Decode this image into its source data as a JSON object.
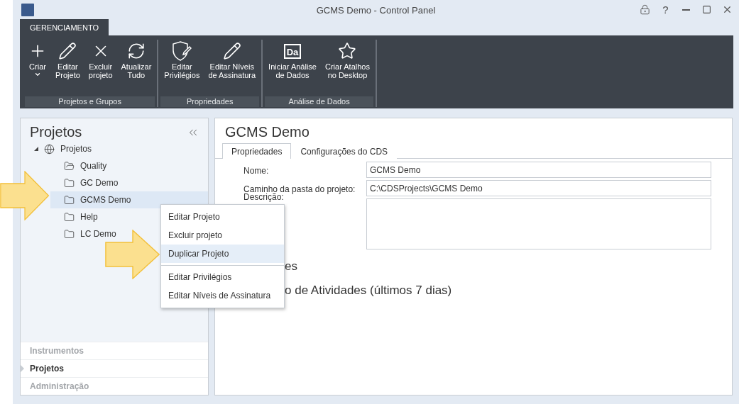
{
  "window": {
    "title": "GCMS Demo - Control Panel",
    "help": "?"
  },
  "ribbon": {
    "tab": "GERENCIAMENTO",
    "groups": [
      {
        "label": "Projetos e Grupos",
        "buttons": [
          {
            "kind": "create",
            "label": "Criar",
            "dropdown": true
          },
          {
            "kind": "edit",
            "label": "Editar\nProjeto",
            "dropdown": false
          },
          {
            "kind": "delete",
            "label": "Excluir\nprojeto",
            "dropdown": false
          },
          {
            "kind": "refresh",
            "label": "Atualizar\nTudo",
            "dropdown": false
          }
        ]
      },
      {
        "label": "Propriedades",
        "buttons": [
          {
            "kind": "privileges",
            "label": "Editar\nPrivilégios",
            "dropdown": false
          },
          {
            "kind": "edit",
            "label": "Editar Níveis\nde Assinatura",
            "dropdown": false
          }
        ]
      },
      {
        "label": "Análise de Dados",
        "buttons": [
          {
            "kind": "analysis",
            "icon_text": "Da",
            "label": "Iniciar Análise\nde Dados",
            "dropdown": false
          },
          {
            "kind": "shortcut",
            "label": "Criar Atalhos\nno Desktop",
            "dropdown": false
          }
        ]
      }
    ]
  },
  "sidebar": {
    "title": "Projetos",
    "tree": {
      "label": "Projetos",
      "expanded": true,
      "children": [
        {
          "label": "Quality",
          "kind": "special",
          "selected": false
        },
        {
          "label": "GC Demo",
          "kind": "plain",
          "selected": false
        },
        {
          "label": "GCMS Demo",
          "kind": "plain",
          "selected": true
        },
        {
          "label": "Help",
          "kind": "plain",
          "selected": false
        },
        {
          "label": "LC Demo",
          "kind": "plain",
          "selected": false
        }
      ]
    },
    "nav": [
      {
        "label": "Instrumentos",
        "selected": false
      },
      {
        "label": "Projetos",
        "selected": true
      },
      {
        "label": "Administração",
        "selected": false
      }
    ]
  },
  "detail": {
    "title": "GCMS Demo",
    "tabs": [
      {
        "label": "Propriedades",
        "selected": true
      },
      {
        "label": "Configurações do CDS",
        "selected": false
      }
    ],
    "fields": [
      {
        "label": "Nome:",
        "kind": "text",
        "value": "GCMS Demo"
      },
      {
        "label": "Caminho da pasta do projeto:",
        "kind": "text",
        "value": "C:\\CDSProjects\\GCMS Demo"
      },
      {
        "label": "Descrição:",
        "kind": "multiline"
      }
    ],
    "sections": [
      "es",
      "o de Atividades (últimos 7 dias)"
    ]
  },
  "context_menu": {
    "groups": [
      [
        {
          "label": "Editar Projeto",
          "selected": false
        },
        {
          "label": "Excluir projeto",
          "selected": false
        },
        {
          "label": "Duplicar Projeto",
          "selected": true
        }
      ],
      [
        {
          "label": "Editar Privilégios",
          "selected": false
        },
        {
          "label": "Editar Níveis de Assinatura",
          "selected": false
        }
      ]
    ]
  }
}
